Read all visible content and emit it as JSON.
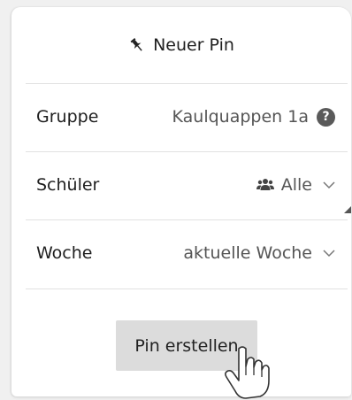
{
  "header": {
    "title": "Neuer Pin",
    "icon": "pushpin-icon"
  },
  "rows": [
    {
      "label": "Gruppe",
      "value": "Kaulquappen 1a",
      "icon": "help-icon",
      "help_glyph": "?"
    },
    {
      "label": "Schüler",
      "value": "Alle",
      "icon": "users-icon",
      "dropdown": true
    },
    {
      "label": "Woche",
      "value": "aktuelle Woche",
      "dropdown": true
    }
  ],
  "button": {
    "label": "Pin erstellen"
  },
  "colors": {
    "background": "#ffffff",
    "button_bg": "#dcdcdc",
    "divider": "#e1e1e1"
  }
}
